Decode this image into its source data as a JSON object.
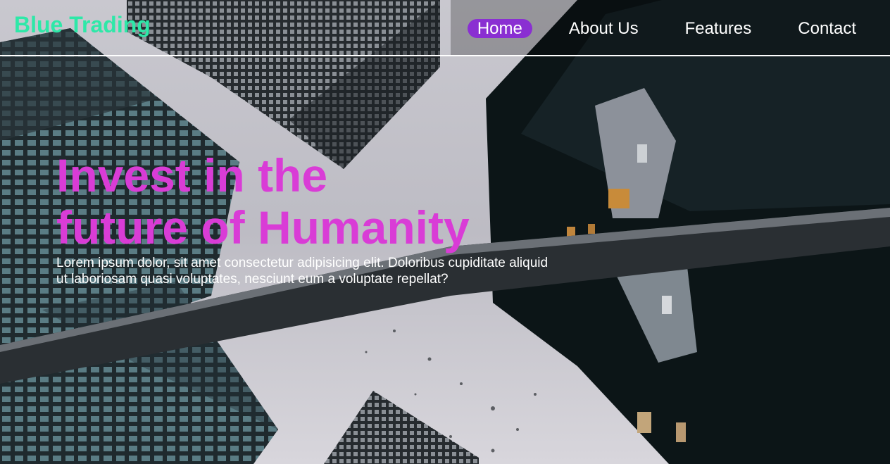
{
  "header": {
    "brand": "Blue Trading",
    "nav": [
      {
        "label": "Home",
        "active": true
      },
      {
        "label": "About Us",
        "active": false
      },
      {
        "label": "Features",
        "active": false
      },
      {
        "label": "Contact",
        "active": false
      }
    ]
  },
  "hero": {
    "headline_line1": "Invest in the",
    "headline_line2": "future of Humanity",
    "lead_line1": "Lorem ipsum dolor, sit amet consectetur adipisicing elit. Doloribus cupiditate aliquid",
    "lead_line2": "ut laboriosam quasi voluptates, nesciunt eum a voluptate repellat?"
  },
  "colors": {
    "brand": "#2ee8a8",
    "headline": "#d93cd6",
    "nav_active_bg": "#8a2fd2",
    "nav_text": "#ffffff"
  }
}
